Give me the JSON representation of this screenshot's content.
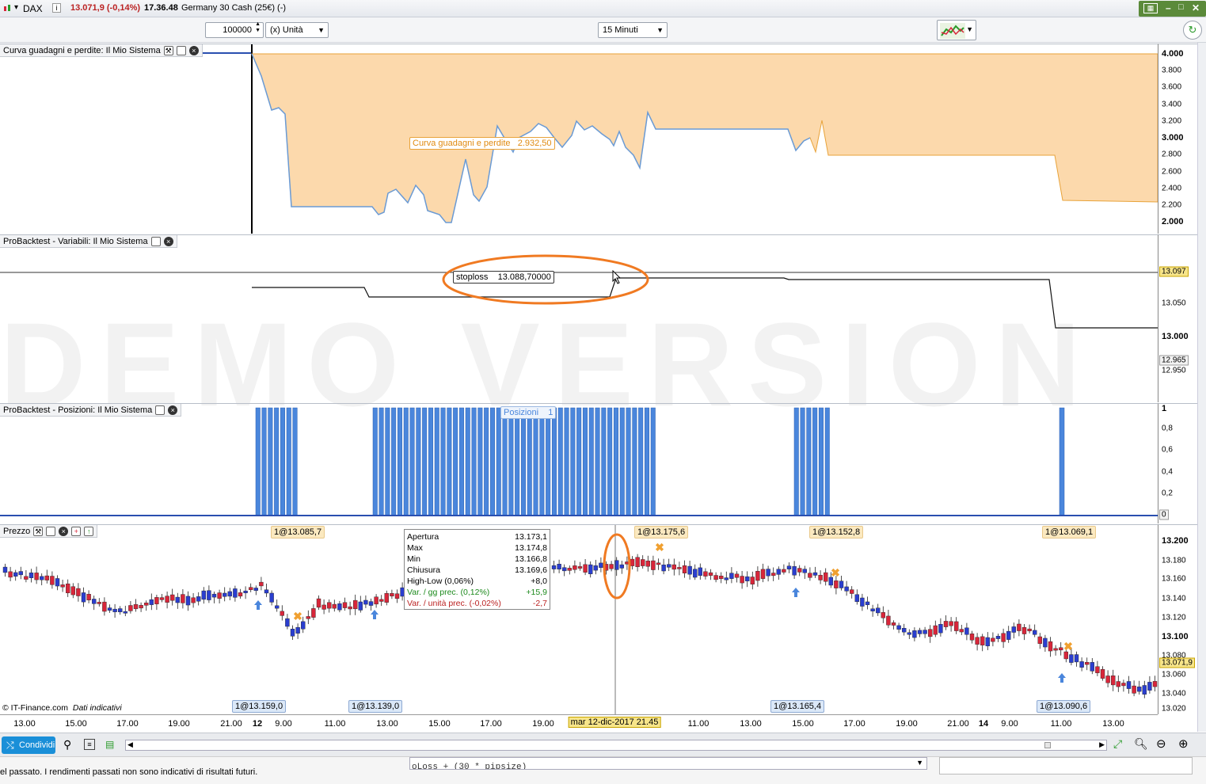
{
  "titlebar": {
    "instrument": "DAX",
    "price": "13.071,9 (-0,14%)",
    "time": "17.36.48",
    "description": "Germany 30 Cash (25€) (-)"
  },
  "toolbar": {
    "quantity": "100000",
    "unit_select": "(x) Unità",
    "timeframe_select": "15 Minuti"
  },
  "watermark": "DEMO VERSION",
  "panels": {
    "equity": {
      "title": "Curva guadagni e perdite: Il Mio Sistema",
      "label": "Curva guadagni e perdite",
      "value": "2.932,50",
      "ticks": [
        "4.000",
        "3.800",
        "3.600",
        "3.400",
        "3.200",
        "3.000",
        "2.800",
        "2.600",
        "2.400",
        "2.200",
        "2.000"
      ]
    },
    "variables": {
      "title": "ProBacktest - Variabili: Il Mio Sistema",
      "stoploss_label": "stoploss",
      "stoploss_value": "13.088,70000",
      "flag_top": "13.097",
      "flag_bottom": "12.965",
      "ticks": [
        "13.050",
        "13.000",
        "12.950"
      ]
    },
    "positions": {
      "title": "ProBacktest - Posizioni: Il Mio Sistema",
      "label": "Posizioni",
      "value": "1",
      "ticks": [
        "1",
        "0,8",
        "0,6",
        "0,4",
        "0,2"
      ],
      "flag_zero": "0"
    },
    "price": {
      "title": "Prezzo",
      "ticks": [
        "13.200",
        "13.180",
        "13.160",
        "13.140",
        "13.120",
        "13.100",
        "13.080",
        "13.060",
        "13.040",
        "13.020"
      ],
      "current_flag": "13.071,9",
      "credit": "© IT-Finance.com",
      "credit_note": "Dati indicativi",
      "top_tags": [
        "1@13.085,7",
        "1@13.175,6",
        "1@13.152,8",
        "1@13.069,1"
      ],
      "bottom_tags": [
        "1@13.159,0",
        "1@13.139,0",
        "1@13.165,4",
        "1@13.090,6"
      ],
      "tooltip": [
        {
          "label": "Apertura",
          "value": "13.173,1",
          "cls": ""
        },
        {
          "label": "Max",
          "value": "13.174,8",
          "cls": ""
        },
        {
          "label": "Min",
          "value": "13.166,8",
          "cls": ""
        },
        {
          "label": "Chiusura",
          "value": "13.169,6",
          "cls": ""
        },
        {
          "label": "High-Low (0,06%)",
          "value": "+8,0",
          "cls": ""
        },
        {
          "label": "Var. / gg prec. (0,12%)",
          "value": "+15,9",
          "cls": "green"
        },
        {
          "label": "Var. / unità prec. (-0,02%)",
          "value": "-2,7",
          "cls": "red"
        }
      ]
    }
  },
  "xaxis": {
    "labels": [
      "13.00",
      "15.00",
      "17.00",
      "19.00",
      "21.00",
      "12",
      "9.00",
      "11.00",
      "13.00",
      "15.00",
      "17.00",
      "19.00",
      "11.00",
      "13.00",
      "15.00",
      "17.00",
      "19.00",
      "21.00",
      "14",
      "9.00",
      "11.00",
      "13.00"
    ],
    "cursor_label": "mar 12-dic-2017 21.45"
  },
  "bottombar": {
    "share_label": "Condividi"
  },
  "status": {
    "disclaimer": "el passato. I rendimenti passati non sono indicativi di risultati futuri.",
    "code_snippet": "oLoss + (30 * pipsize)"
  },
  "colors": {
    "equity_fill": "#fcd9ac",
    "equity_line": "#6a9bd6",
    "position_bar": "#4a86dc",
    "candle_up": "#2a3ecf",
    "candle_down": "#d8263a",
    "highlight_ellipse": "#f07a22"
  }
}
